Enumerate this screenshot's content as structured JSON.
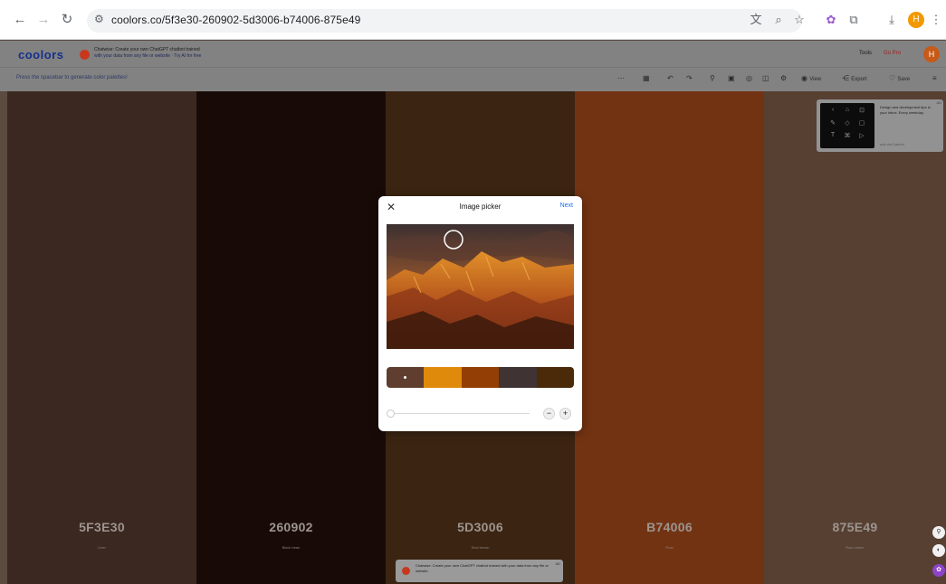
{
  "browser": {
    "url": "coolors.co/5f3e30-260902-5d3006-b74006-875e49",
    "profile_initial": "H"
  },
  "header": {
    "logo": "coolors",
    "promo_title": "Chatwise: Create your own ChatGPT chatbot trained",
    "promo_sub": "with your data from any file or website · Try AI for free",
    "tools": "Tools",
    "go_pro": "Go Pro",
    "avatar_initial": "H",
    "hint": "Press the spacebar to generate color palettes!",
    "view_label": "View",
    "export_label": "Export",
    "save_label": "Save"
  },
  "palette": [
    {
      "hex": "5F3E30",
      "name": "Liver",
      "color": "#5f3e30"
    },
    {
      "hex": "260902",
      "name": "Black bean",
      "color": "#260902"
    },
    {
      "hex": "5D3006",
      "name": "Seal brown",
      "color": "#5d3006"
    },
    {
      "hex": "B74006",
      "name": "Rust",
      "color": "#b74006"
    },
    {
      "hex": "875E49",
      "name": "Raw umber",
      "color": "#875e49"
    }
  ],
  "mini_card": {
    "text": "Design and development tips in your inbox. Every weekday.",
    "sub": "ads via Carbon",
    "ad": "AD"
  },
  "bottom_promo": {
    "text": "Chatwise: Create your own ChatGPT chatbot trained with your data from any file or website.",
    "ad": "AD"
  },
  "modal": {
    "title": "Image picker",
    "next": "Next",
    "swatches": [
      "#5f3e30",
      "#e08a0c",
      "#923e05",
      "#3f3433",
      "#4a2a09"
    ],
    "slider_value": 0
  }
}
